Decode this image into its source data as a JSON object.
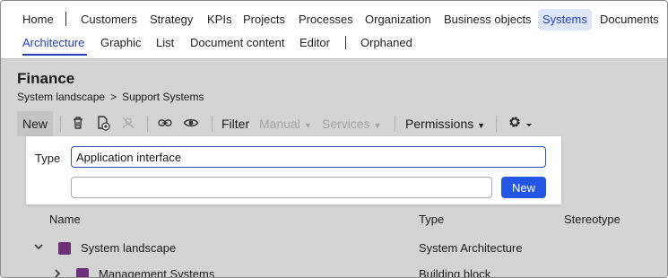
{
  "nav": {
    "main": [
      {
        "label": "Home"
      },
      {
        "label": "Customers"
      },
      {
        "label": "Strategy"
      },
      {
        "label": "KPIs"
      },
      {
        "label": "Projects"
      },
      {
        "label": "Processes"
      },
      {
        "label": "Organization"
      },
      {
        "label": "Business objects"
      },
      {
        "label": "Systems"
      },
      {
        "label": "Documents"
      }
    ],
    "sub": [
      {
        "label": "Architecture"
      },
      {
        "label": "Graphic"
      },
      {
        "label": "List"
      },
      {
        "label": "Document content"
      },
      {
        "label": "Editor"
      },
      {
        "label": "Orphaned"
      }
    ]
  },
  "page": {
    "title": "Finance",
    "breadcrumb": [
      "System landscape",
      ">",
      "Support Systems"
    ]
  },
  "toolbar": {
    "new_label": "New",
    "filter_label": "Filter",
    "manual_label": "Manual",
    "services_label": "Services",
    "permissions_label": "Permissions",
    "icons": [
      "trash-icon",
      "add-document-icon",
      "disabled-user-icon",
      "link-icon",
      "eye-icon",
      "gear-icon"
    ]
  },
  "popup": {
    "type_label": "Type",
    "type_value": "Application interface",
    "name_value": "",
    "new_button": "New"
  },
  "table": {
    "headers": [
      "Name",
      "Type",
      "Stereotype"
    ],
    "rows": [
      {
        "name": "System landscape",
        "type": "System Architecture",
        "expander": "v"
      },
      {
        "name": "Management Systems",
        "type": "Building block",
        "expander": ">"
      }
    ]
  },
  "colors": {
    "accent": "#1f3fbf",
    "primary_button": "#2456e6",
    "object_square": "#6d2f7a",
    "overlay": "#d4d4d4"
  }
}
